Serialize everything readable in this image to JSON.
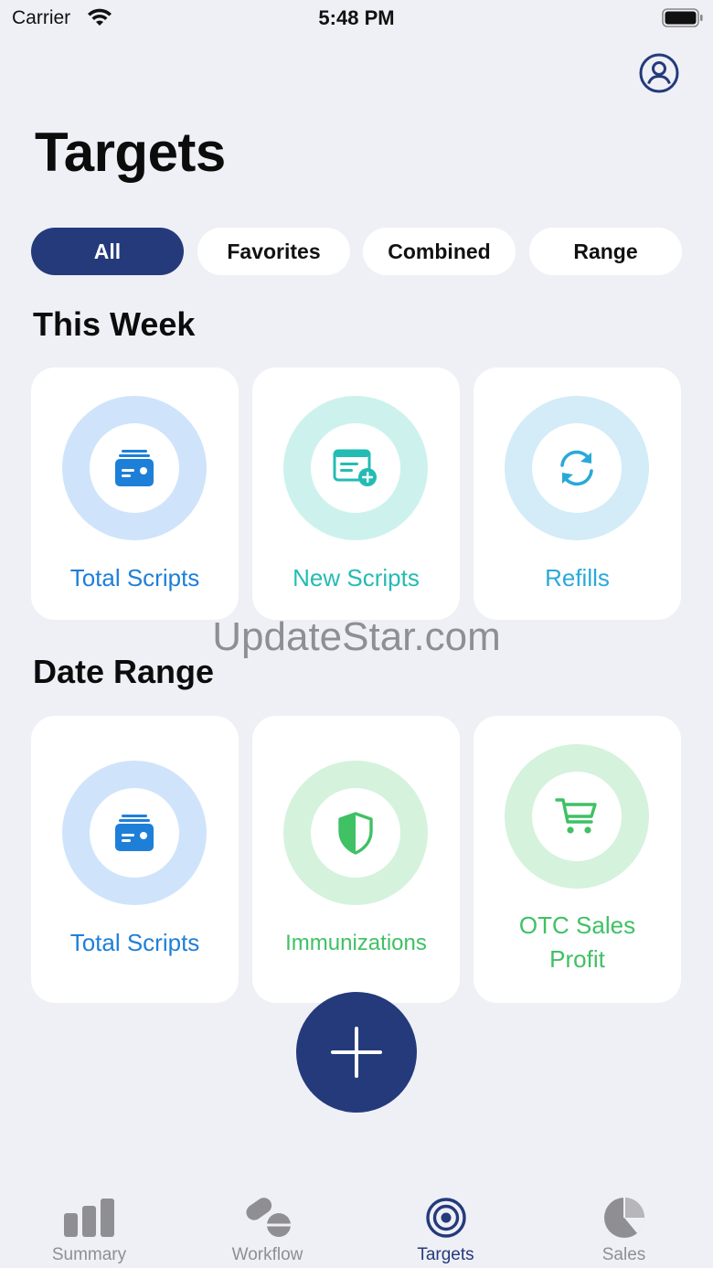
{
  "status_bar": {
    "carrier": "Carrier",
    "time": "5:48 PM"
  },
  "header": {
    "title": "Targets",
    "profile_icon": "person-circle-icon"
  },
  "filters": [
    {
      "label": "All",
      "active": true
    },
    {
      "label": "Favorites",
      "active": false
    },
    {
      "label": "Combined",
      "active": false
    },
    {
      "label": "Range",
      "active": false
    }
  ],
  "sections": {
    "this_week": {
      "title": "This Week",
      "cards": [
        {
          "label": "Total Scripts",
          "icon": "script-stack-icon",
          "color": "#1e7fd8",
          "ring": "#cfe4fb"
        },
        {
          "label": "New Scripts",
          "icon": "new-script-icon",
          "color": "#23bcb4",
          "ring": "#cdf2ee"
        },
        {
          "label": "Refills",
          "icon": "refresh-icon",
          "color": "#2aa9d8",
          "ring": "#d3ecf7"
        }
      ]
    },
    "date_range": {
      "title": "Date Range",
      "cards": [
        {
          "label": "Total Scripts",
          "icon": "script-stack-icon",
          "color": "#1e7fd8",
          "ring": "#cfe4fb"
        },
        {
          "label": "Immunizations",
          "icon": "shield-icon",
          "color": "#3fc164",
          "ring": "#d5f2dc"
        },
        {
          "label_line1": "OTC Sales",
          "label_line2": "Profit",
          "icon": "cart-icon",
          "color": "#3fc164",
          "ring": "#d5f2dc"
        }
      ]
    }
  },
  "watermark": "UpdateStar.com",
  "fab": {
    "icon": "plus-icon"
  },
  "tab_bar": [
    {
      "label": "Summary",
      "icon": "bar-chart-icon",
      "active": false
    },
    {
      "label": "Workflow",
      "icon": "pills-icon",
      "active": false
    },
    {
      "label": "Targets",
      "icon": "target-icon",
      "active": true
    },
    {
      "label": "Sales",
      "icon": "pie-chart-icon",
      "active": false
    }
  ],
  "colors": {
    "accent": "#243a7b",
    "background": "#eff0f6",
    "inactive_tab": "#8e8e93"
  }
}
